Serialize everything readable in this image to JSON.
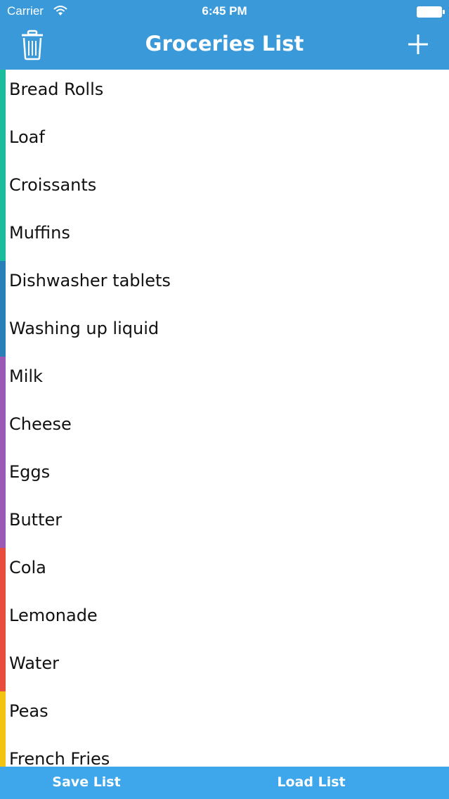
{
  "status": {
    "carrier": "Carrier",
    "time": "6:45 PM"
  },
  "header": {
    "title": "Groceries List",
    "delete_icon": "trash-icon",
    "add_icon": "plus-icon"
  },
  "colors": {
    "header": "#3a9ad9",
    "footer": "#3ea6ea",
    "bakery": "#1abc9c",
    "household": "#2980b9",
    "dairy": "#9b59b6",
    "drinks": "#e74c3c",
    "frozen": "#f1c40f"
  },
  "items": [
    {
      "label": "Bread Rolls",
      "color": "#1abc9c"
    },
    {
      "label": "Loaf",
      "color": "#1abc9c"
    },
    {
      "label": "Croissants",
      "color": "#1abc9c"
    },
    {
      "label": "Muffins",
      "color": "#1abc9c"
    },
    {
      "label": "Dishwasher tablets",
      "color": "#2980b9"
    },
    {
      "label": "Washing up liquid",
      "color": "#2980b9"
    },
    {
      "label": "Milk",
      "color": "#9b59b6"
    },
    {
      "label": "Cheese",
      "color": "#9b59b6"
    },
    {
      "label": "Eggs",
      "color": "#9b59b6"
    },
    {
      "label": "Butter",
      "color": "#9b59b6"
    },
    {
      "label": "Cola",
      "color": "#e74c3c"
    },
    {
      "label": "Lemonade",
      "color": "#e74c3c"
    },
    {
      "label": "Water",
      "color": "#e74c3c"
    },
    {
      "label": "Peas",
      "color": "#f1c40f"
    },
    {
      "label": "French Fries",
      "color": "#f1c40f"
    }
  ],
  "footer": {
    "save_label": "Save List",
    "load_label": "Load List"
  }
}
